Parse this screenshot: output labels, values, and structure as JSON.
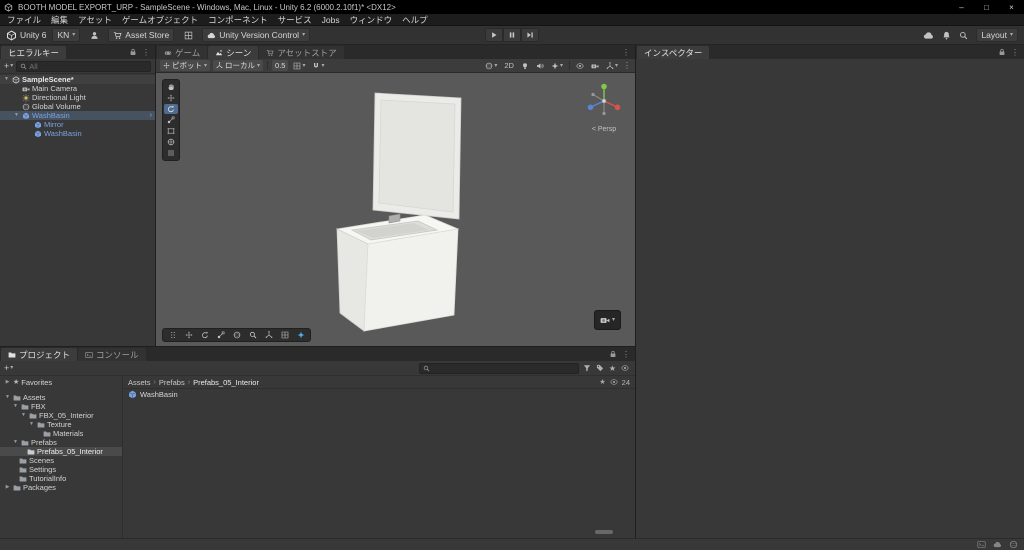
{
  "colors": {
    "prefab_text": "#7ba3e3",
    "hierarchy_selection": "#475260",
    "project_selection": "#4a4a4a",
    "scene_background": "#595959",
    "tool_active": "#4f6b8f",
    "accent": "#56b3e8"
  },
  "icons": {
    "caret": "▾",
    "kebab": "⋮",
    "plus": "+",
    "arrow_down": "▼",
    "arrow_right": "▶",
    "chevron": "›",
    "star": "★",
    "minimize": "–",
    "maximize": "□",
    "close": "×",
    "crumb_sep": "›"
  },
  "titlebar": {
    "title": "BOOTH MODEL EXPORT_URP - SampleScene - Windows, Mac, Linux - Unity 6.2 (6000.2.10f1)* <DX12>"
  },
  "menubar": {
    "items": [
      "ファイル",
      "編集",
      "アセット",
      "ゲームオブジェクト",
      "コンポーネント",
      "サービス",
      "Jobs",
      "ウィンドウ",
      "ヘルプ"
    ]
  },
  "toolbar": {
    "unity_badge": "Unity 6",
    "account": "KN",
    "asset_store": "Asset Store",
    "version_control": "Unity Version Control",
    "layout": "Layout"
  },
  "hierarchy": {
    "tab": "ヒエラルキー",
    "search_placeholder": "All",
    "scene_row": "SampleScene*",
    "items": [
      "Main Camera",
      "Directional Light",
      "Global Volume",
      "WashBasin",
      "Mirror",
      "WashBasin"
    ]
  },
  "scene": {
    "tabs": [
      "ゲーム",
      "シーン",
      "アセットストア"
    ],
    "toolbar": {
      "pivot": "ピボット",
      "orientation": "ローカル",
      "snap_value": "0.5",
      "two_d": "2D"
    },
    "persp_label": "< Persp"
  },
  "inspector": {
    "tab": "インスペクター"
  },
  "project": {
    "tabs": [
      "プロジェクト",
      "コンソール"
    ],
    "favorites": "Favorites",
    "tree": [
      "Assets",
      "FBX",
      "FBX_05_Interior",
      "Texture",
      "Materials",
      "Prefabs",
      "Prefabs_05_Interior",
      "Scenes",
      "Settings",
      "TutorialInfo",
      "Packages"
    ],
    "breadcrumbs": [
      "Assets",
      "Prefabs",
      "Prefabs_05_Interior"
    ],
    "hidden_count": "24",
    "items": [
      "WashBasin"
    ]
  }
}
